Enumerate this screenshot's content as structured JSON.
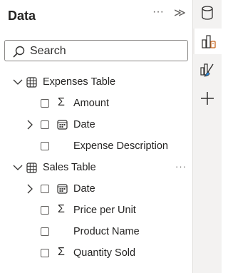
{
  "pane": {
    "title": "Data",
    "more": "···",
    "collapse": "≫"
  },
  "search": {
    "placeholder": "Search"
  },
  "tables": [
    {
      "name": "Expenses Table",
      "fields": [
        {
          "name": "Amount"
        },
        {
          "name": "Date"
        },
        {
          "name": "Expense Description"
        }
      ]
    },
    {
      "name": "Sales Table",
      "more": "···",
      "fields": [
        {
          "name": "Date"
        },
        {
          "name": "Price per Unit"
        },
        {
          "name": "Product Name"
        },
        {
          "name": "Quantity Sold"
        }
      ]
    }
  ],
  "colors": {
    "accent": "#c8661f",
    "border": "#e1dfdd"
  }
}
